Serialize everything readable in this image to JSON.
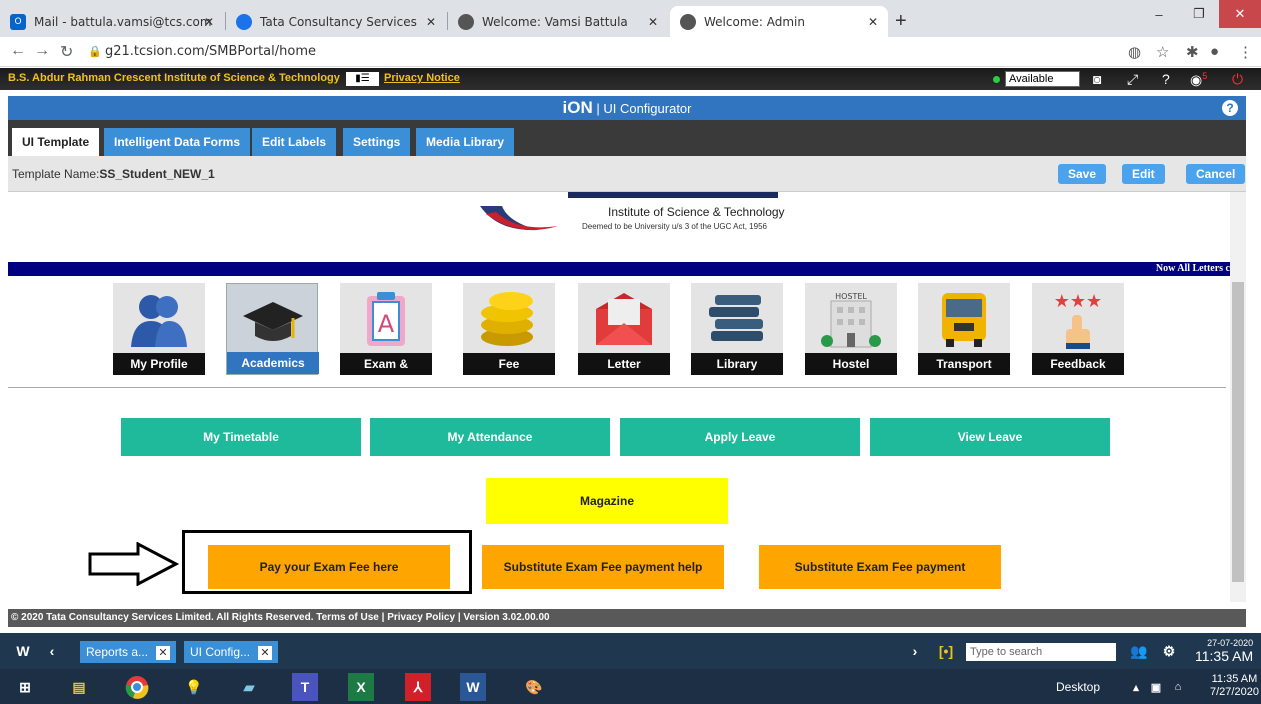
{
  "browser": {
    "tabs": [
      {
        "title": "Mail - battula.vamsi@tcs.com",
        "icon": "outlook-icon"
      },
      {
        "title": "Tata Consultancy Services",
        "icon": "tcs-icon"
      },
      {
        "title": "Welcome: Vamsi Battula",
        "icon": "globe-icon"
      },
      {
        "title": "Welcome: Admin",
        "icon": "globe-icon"
      }
    ],
    "url": "g21.tcsion.com/SMBPortal/home"
  },
  "institute_bar": {
    "name": "B.S. Abdur Rahman Crescent Institute of Science & Technology",
    "privacy": "Privacy Notice",
    "status": "Available",
    "notification_count": "5"
  },
  "header": {
    "brand": "iON",
    "title": "UI Configurator"
  },
  "config_tabs": [
    "UI Template",
    "Intelligent Data Forms",
    "Edit Labels",
    "Settings",
    "Media Library"
  ],
  "template": {
    "label": "Template Name:",
    "name": "SS_Student_NEW_1",
    "save": "Save",
    "edit": "Edit",
    "cancel": "Cancel"
  },
  "logo": {
    "line1": "Institute of Science & Technology",
    "line2": "Deemed to be University u/s 3 of the UGC Act, 1956"
  },
  "marquee": "Now All Letters c",
  "tiles": [
    "My Profile",
    "Academics",
    "Exam & Grading",
    "Fee",
    "Letter",
    "Library",
    "Hostel",
    "Transport",
    "Feedback"
  ],
  "quick_links": [
    "My Timetable",
    "My Attendance",
    "Apply Leave",
    "View Leave"
  ],
  "magazine": "Magazine",
  "exam_fee": [
    "Pay your Exam Fee here",
    "Substitute Exam Fee payment help manual",
    "Substitute Exam Fee payment"
  ],
  "footer": "© 2020 Tata Consultancy Services Limited. All Rights Reserved. Terms of Use | Privacy Policy | Version 3.02.00.00",
  "taskbar_top": {
    "items": [
      "Reports a...",
      "UI Config..."
    ],
    "search": "Type to search",
    "date": "27-07-2020",
    "time": "11:35 AM"
  },
  "taskbar_bottom": {
    "desktop": "Desktop",
    "time": "11:35 AM",
    "date": "7/27/2020"
  }
}
